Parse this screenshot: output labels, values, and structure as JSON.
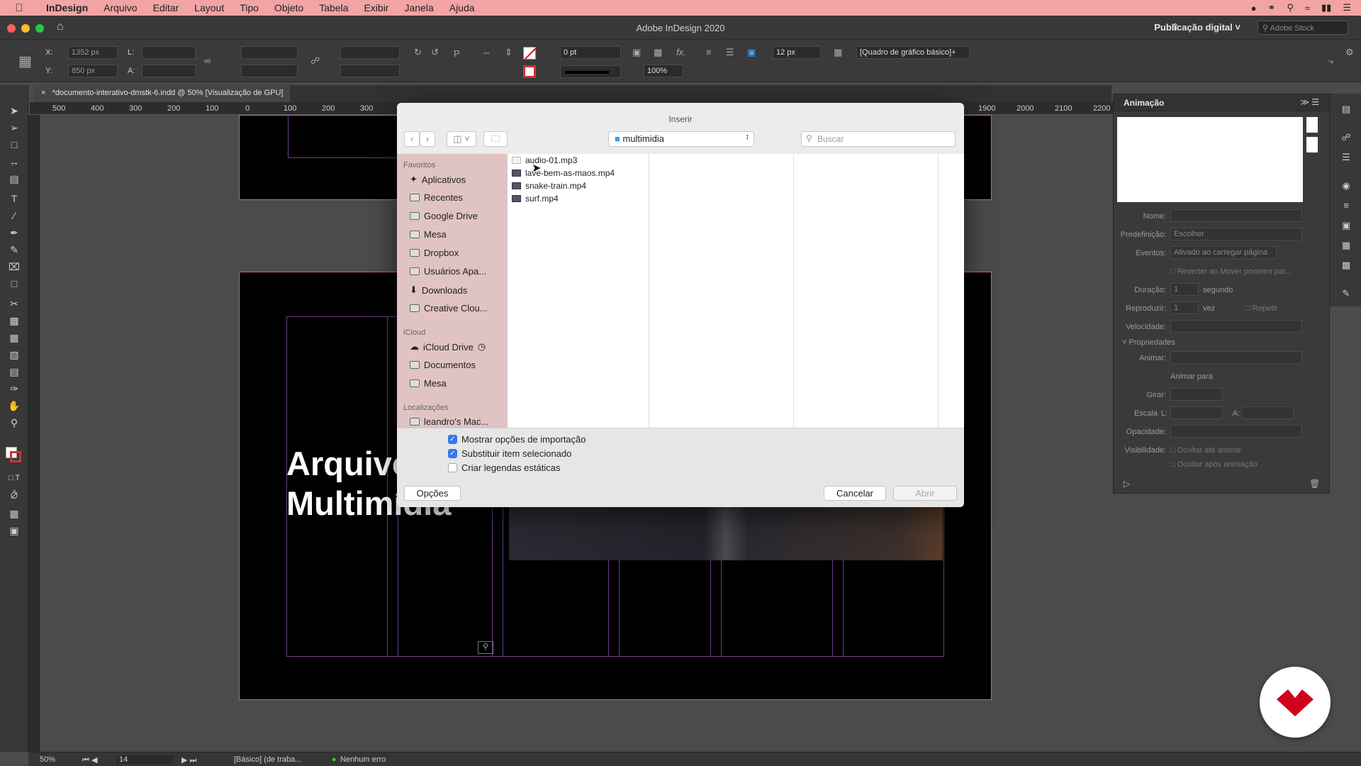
{
  "menubar": {
    "app": "InDesign",
    "items": [
      "Arquivo",
      "Editar",
      "Layout",
      "Tipo",
      "Objeto",
      "Tabela",
      "Exibir",
      "Janela",
      "Ajuda"
    ]
  },
  "window": {
    "title": "Adobe InDesign 2020",
    "workspace": "Publicação digital",
    "stock_placeholder": "Adobe Stock"
  },
  "control": {
    "x_label": "X:",
    "x_value": "1352 px",
    "y_label": "Y:",
    "y_value": "850 px",
    "w_label": "L:",
    "h_label": "A:",
    "stroke_weight": "0 pt",
    "opacity": "100%",
    "gap": "12 px",
    "frame_style": "[Quadro de gráfico básico]+"
  },
  "doc_tab": {
    "close": "×",
    "label": "*documento-interativo-dmstk-6.indd @ 50% [Visualização de GPU]"
  },
  "ruler": {
    "h_ticks": [
      "500",
      "400",
      "300",
      "200",
      "100",
      "0",
      "100",
      "200",
      "300",
      "1900",
      "2000",
      "2100",
      "2200"
    ]
  },
  "page": {
    "heading_line1": "Arquivo",
    "heading_line2": "Multimídia"
  },
  "animation_panel": {
    "title": "Animação",
    "name_label": "Nome:",
    "preset_label": "Predefinição:",
    "preset_value": "Escolher",
    "events_label": "Eventos:",
    "events_value": "Ativado ao carregar página",
    "revert_label": "Reverter ao Mover ponteiro par...",
    "duration_label": "Duração:",
    "duration_value": "1",
    "duration_unit": "segundo",
    "play_label": "Reproduzir:",
    "play_value": "1",
    "play_unit": "vez",
    "repeat_label": "Repetir",
    "speed_label": "Velocidade:",
    "properties_label": "Propriedades",
    "animate_label": "Animar:",
    "animate_to_label": "Animar para",
    "rotate_label": "Girar:",
    "scale_label": "Escala",
    "scale_w": "L:",
    "scale_h": "A:",
    "opacity_label": "Opacidade:",
    "visibility_label": "Visibilidade:",
    "hide_until": "Ocultar até animar",
    "hide_after": "Ocultar após animação"
  },
  "statusbar": {
    "zoom": "50%",
    "page": "14",
    "profile": "[Básico] (de traba...",
    "preflight": "Nenhum erro"
  },
  "dialog": {
    "title": "Inserir",
    "location": "multimidia",
    "search_placeholder": "Buscar",
    "sidebar": {
      "favorites_label": "Favoritos",
      "favorites": [
        "Aplicativos",
        "Recentes",
        "Google Drive",
        "Mesa",
        "Dropbox",
        "Usuários Apa...",
        "Downloads",
        "Creative Clou..."
      ],
      "icloud_label": "iCloud",
      "icloud": [
        "iCloud Drive",
        "Documentos",
        "Mesa"
      ],
      "locations_label": "Localizações",
      "locations": [
        "leandro's Mac..."
      ]
    },
    "files": [
      "audio-01.mp3",
      "lave-bem-as-maos.mp4",
      "snake-train.mp4",
      "surf.mp4"
    ],
    "options": {
      "show_import": "Mostrar opções de importação",
      "show_import_checked": true,
      "replace_selected": "Substituir item selecionado",
      "replace_selected_checked": true,
      "static_captions": "Criar legendas estáticas",
      "static_captions_checked": false
    },
    "buttons": {
      "options": "Opções",
      "cancel": "Cancelar",
      "open": "Abrir"
    }
  },
  "colors": {
    "menubar": "#f2a4a4",
    "sidebar": "#e0c3c3",
    "accent_blue": "#2f7be9",
    "logo_red": "#d0021b"
  }
}
